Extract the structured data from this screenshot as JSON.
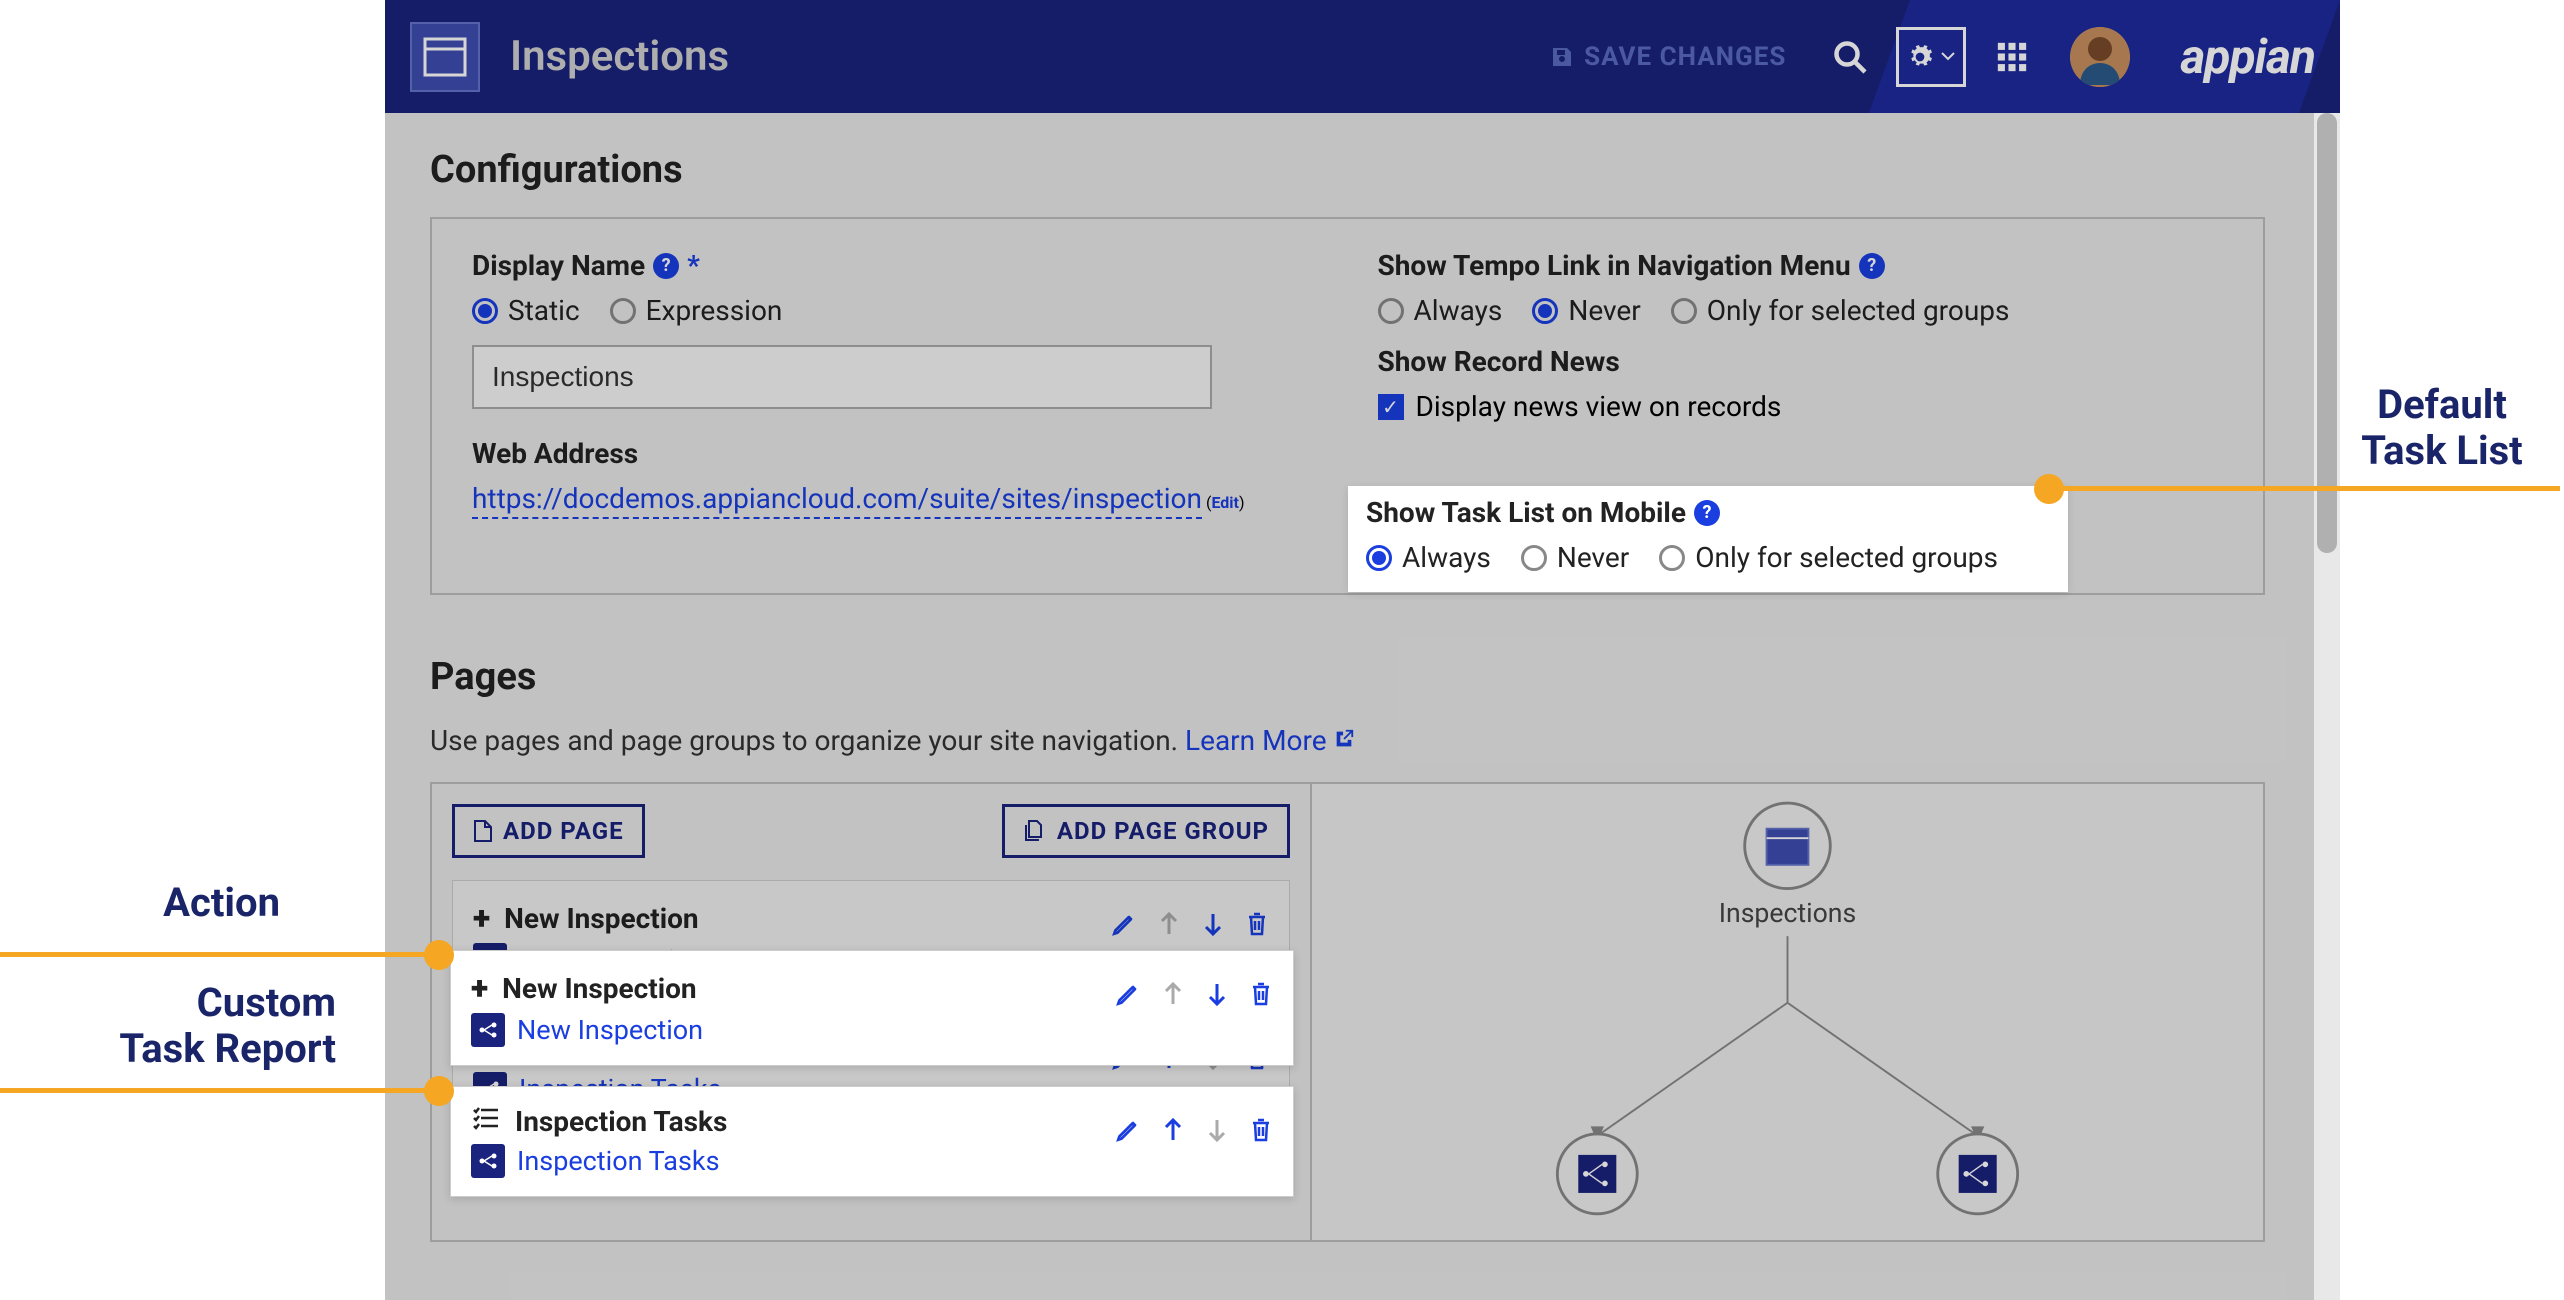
{
  "header": {
    "title": "Inspections",
    "save_label": "SAVE CHANGES",
    "brand": "appian"
  },
  "annotations": {
    "default_task_list": "Default\nTask List",
    "action": "Action",
    "custom_task_report": "Custom\nTask Report"
  },
  "config": {
    "section_title": "Configurations",
    "display_name_label": "Display Name",
    "display_name_opts": {
      "static": "Static",
      "expression": "Expression"
    },
    "display_name_value": "Inspections",
    "web_address_label": "Web Address",
    "web_url": "https://docdemos.appiancloud.com/suite/sites/inspection",
    "edit_label": "Edit",
    "tempo_label": "Show Tempo Link in Navigation Menu",
    "tempo_opts": {
      "always": "Always",
      "never": "Never",
      "groups": "Only for selected groups"
    },
    "record_news_label": "Show Record News",
    "record_news_check": "Display news view on records",
    "task_list_label": "Show Task List on Mobile",
    "task_list_opts": {
      "always": "Always",
      "never": "Never",
      "groups": "Only for selected groups"
    }
  },
  "pages": {
    "section_title": "Pages",
    "desc": "Use pages and page groups to organize your site navigation. ",
    "learn_more": "Learn More",
    "add_page": "ADD PAGE",
    "add_group": "ADD PAGE GROUP",
    "items": [
      {
        "title": "New Inspection",
        "link": "New Inspection",
        "icon": "plus"
      },
      {
        "title": "Inspection Tasks",
        "link": "Inspection Tasks",
        "icon": "list"
      }
    ],
    "sitemap_root": "Inspections"
  }
}
